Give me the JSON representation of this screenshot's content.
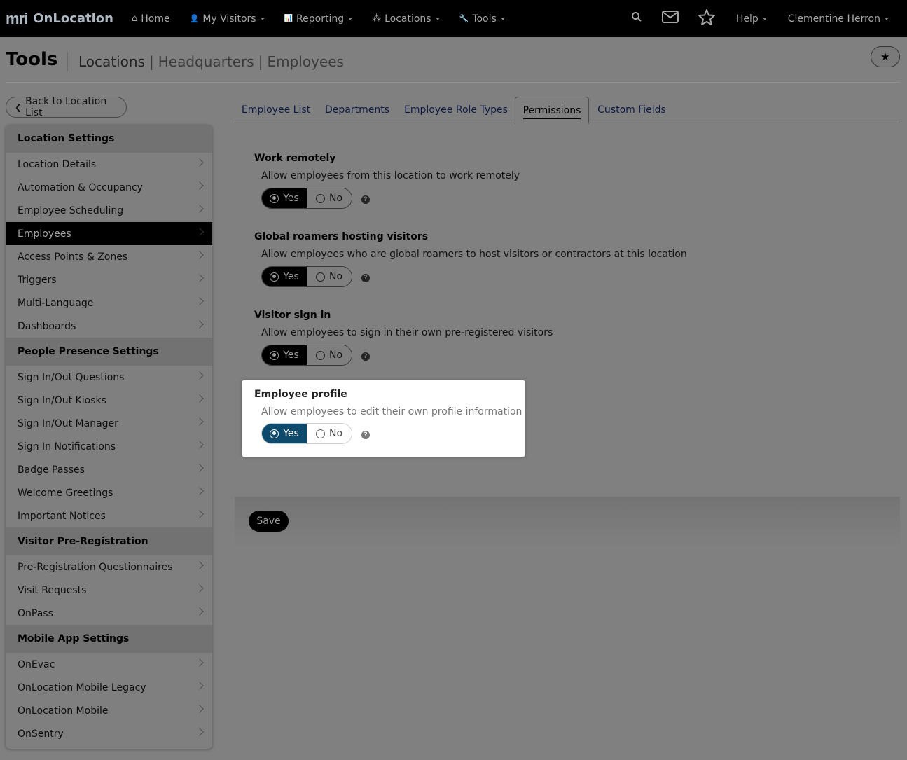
{
  "nav": {
    "logo": "mri",
    "app_name": "OnLocation",
    "items": [
      {
        "label": "Home",
        "icon": "home-icon",
        "glyph": "⌂"
      },
      {
        "label": "My Visitors",
        "icon": "user-icon",
        "glyph": "👤"
      },
      {
        "label": "Reporting",
        "icon": "bar-chart-icon",
        "glyph": "📊"
      },
      {
        "label": "Locations",
        "icon": "network-icon",
        "glyph": "⁂"
      },
      {
        "label": "Tools",
        "icon": "wrench-icon",
        "glyph": "🔧"
      }
    ],
    "help_label": "Help",
    "user_name": "Clementine Herron"
  },
  "header": {
    "title": "Tools",
    "breadcrumb": [
      "Locations",
      "Headquarters",
      "Employees"
    ]
  },
  "back_label": "Back to Location List",
  "sidebar": {
    "sections": [
      {
        "title": "Location Settings",
        "items": [
          "Location Details",
          "Automation & Occupancy",
          "Employee Scheduling",
          "Employees",
          "Access Points & Zones",
          "Triggers",
          "Multi-Language",
          "Dashboards"
        ]
      },
      {
        "title": "People Presence Settings",
        "items": [
          "Sign In/Out Questions",
          "Sign In/Out Kiosks",
          "Sign In/Out Manager",
          "Sign In Notifications",
          "Badge Passes",
          "Welcome Greetings",
          "Important Notices"
        ]
      },
      {
        "title": "Visitor Pre-Registration",
        "items": [
          "Pre-Registration Questionnaires",
          "Visit Requests",
          "OnPass"
        ]
      },
      {
        "title": "Mobile App Settings",
        "items": [
          "OnEvac",
          "OnLocation Mobile Legacy",
          "OnLocation Mobile",
          "OnSentry"
        ]
      }
    ],
    "active_item": "Employees"
  },
  "tabs": [
    {
      "label": "Employee List"
    },
    {
      "label": "Departments"
    },
    {
      "label": "Employee Role Types"
    },
    {
      "label": "Permissions"
    },
    {
      "label": "Custom Fields"
    }
  ],
  "active_tab": "Permissions",
  "settings": [
    {
      "title": "Work remotely",
      "desc": "Allow employees from this location to work remotely",
      "yes": "Yes",
      "no": "No",
      "value": "Yes"
    },
    {
      "title": "Global roamers hosting visitors",
      "desc": "Allow employees who are global roamers to host visitors or contractors at this location",
      "yes": "Yes",
      "no": "No",
      "value": "Yes"
    },
    {
      "title": "Visitor sign in",
      "desc": "Allow employees to sign in their own pre-registered visitors",
      "yes": "Yes",
      "no": "No",
      "value": "Yes"
    },
    {
      "title": "Employee profile",
      "desc": "Allow employees to edit their own profile information",
      "yes": "Yes",
      "no": "No",
      "value": "Yes"
    }
  ],
  "help_glyph": "?",
  "save_label": "Save"
}
